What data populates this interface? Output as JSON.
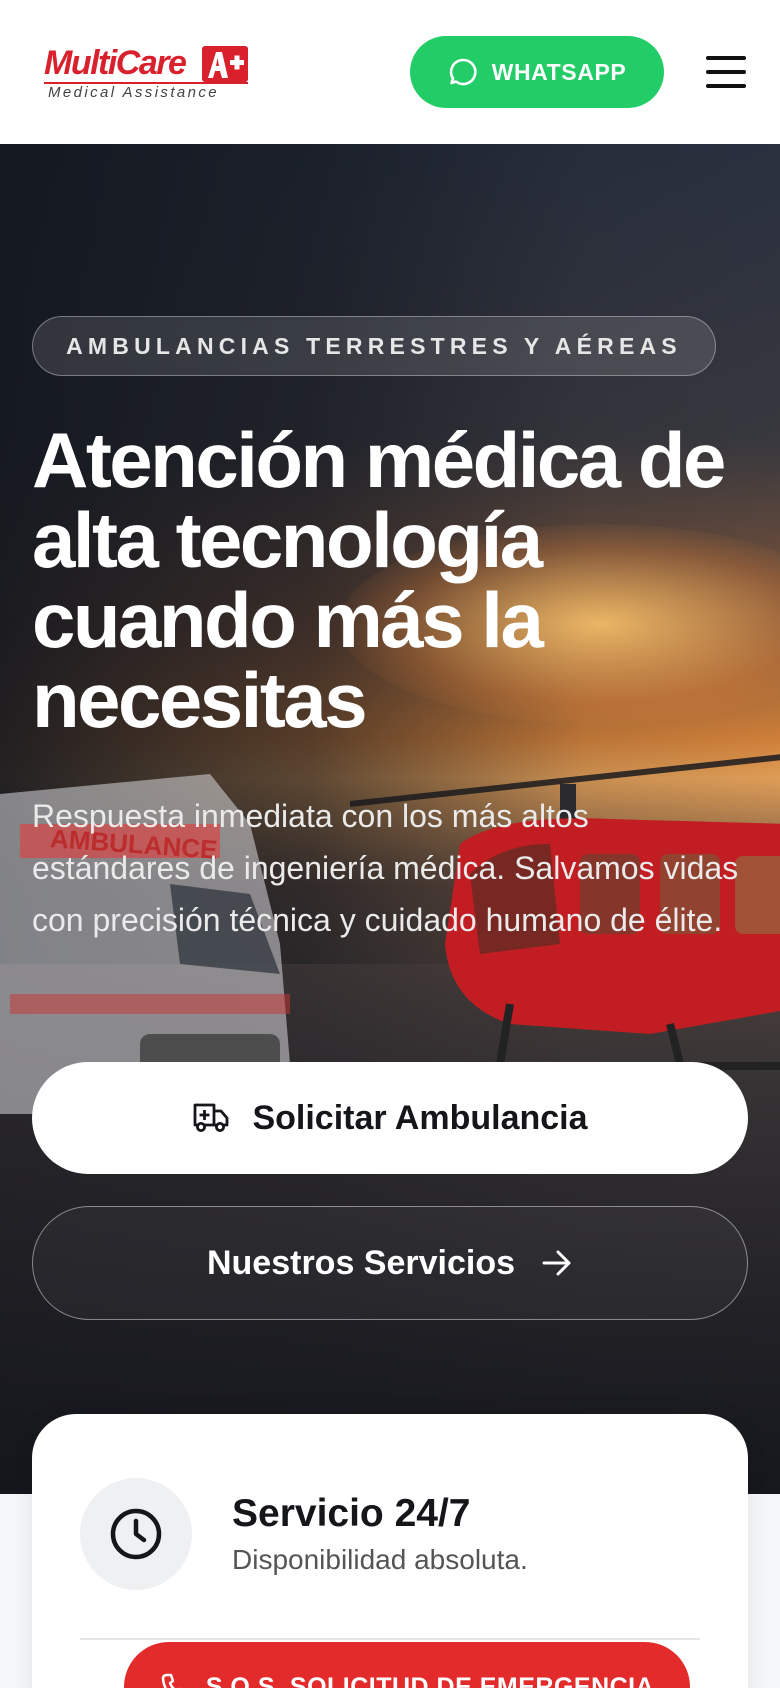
{
  "header": {
    "logo": {
      "name": "MultiCare",
      "tagline": "Medical Assistance",
      "mark": "A+"
    },
    "whatsapp_label": "WHATSAPP",
    "menu_icon": "hamburger-menu-icon"
  },
  "hero": {
    "badge": "AMBULANCIAS TERRESTRES Y AÉREAS",
    "title_line1": "Atención médica de",
    "title_line2": "alta tecnología",
    "title_line3": "cuando más la",
    "title_line4": "necesitas",
    "description": "Respuesta inmediata con los más altos estándares de ingeniería médica. Salvamos vidas con precisión técnica y cuidado humano de élite.",
    "primary_button": "Solicitar Ambulancia",
    "secondary_button": "Nuestros Servicios",
    "background_labels": {
      "ambulance_text": "AMBULANCE"
    }
  },
  "card": {
    "title": "Servicio 24/7",
    "subtitle": "Disponibilidad absoluta.",
    "sos_button": "S.O.S. SOLICITUD DE EMERGENCIA"
  },
  "colors": {
    "brand_red": "#d8212c",
    "whatsapp_green": "#22cc66",
    "sos_red": "#e32b2b"
  }
}
